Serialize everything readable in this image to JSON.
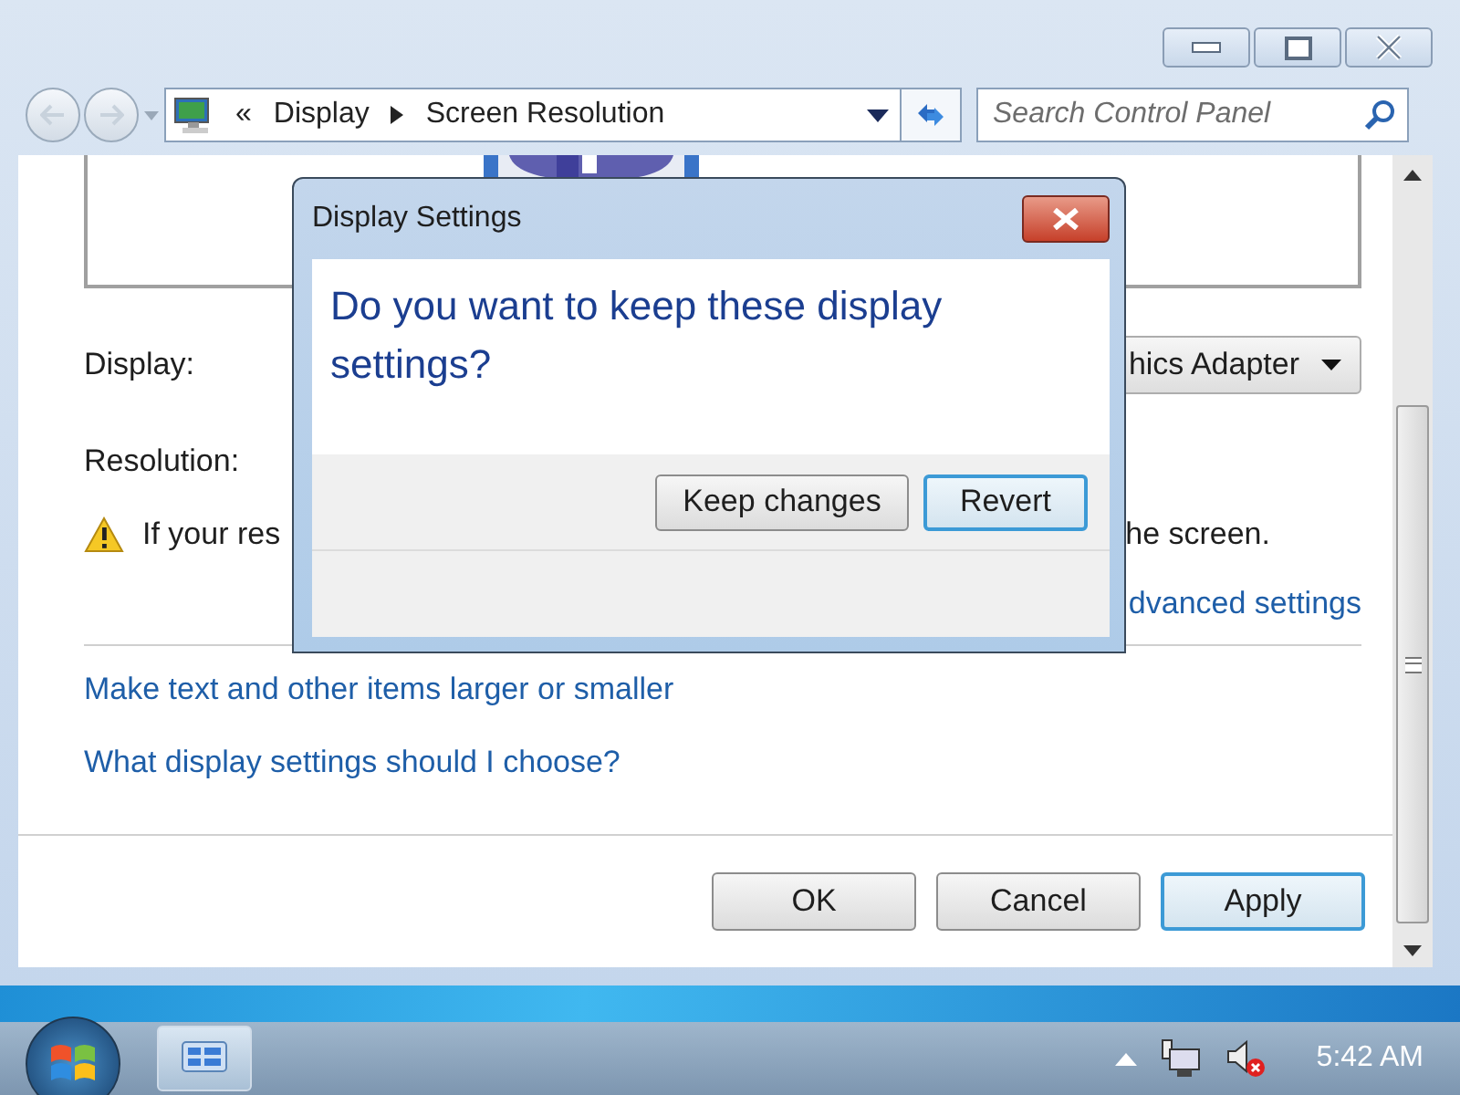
{
  "address_bar": {
    "overflow": "«",
    "crumbs": [
      "Display",
      "Screen Resolution"
    ]
  },
  "search": {
    "placeholder": "Search Control Panel"
  },
  "content": {
    "display_label": "Display:",
    "display_dropdown": "hics Adapter",
    "resolution_label": "Resolution:",
    "warning_start": "If your res",
    "warning_end": "he screen.",
    "advanced_link": "dvanced settings",
    "links": [
      "Make text and other items larger or smaller",
      "What display settings should I choose?"
    ],
    "buttons": [
      {
        "label": "OK",
        "focused": false
      },
      {
        "label": "Cancel",
        "focused": false
      },
      {
        "label": "Apply",
        "focused": true
      }
    ]
  },
  "dialog": {
    "title": "Display Settings",
    "question": "Do you want to keep these display settings?",
    "buttons": [
      {
        "label": "Keep changes",
        "focused": false
      },
      {
        "label": "Revert",
        "focused": true
      }
    ]
  },
  "taskbar": {
    "clock": "5:42 AM"
  }
}
